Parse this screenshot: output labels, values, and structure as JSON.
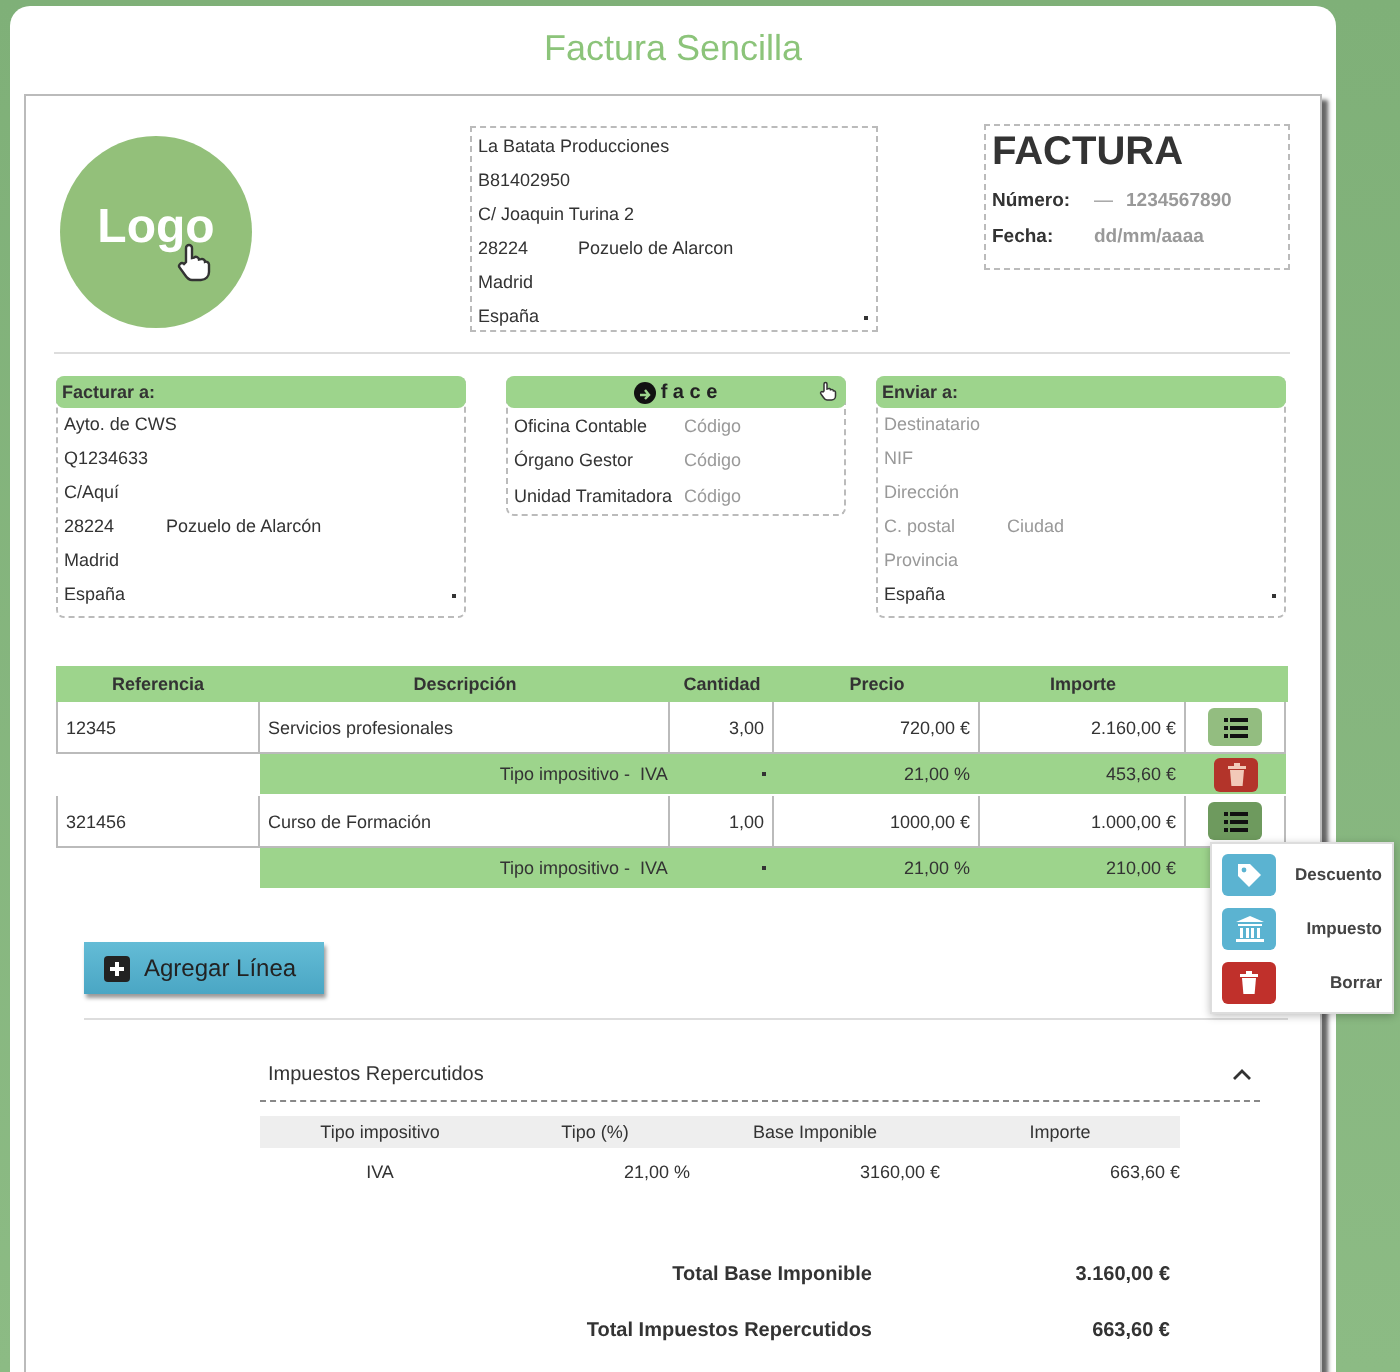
{
  "page_title": "Factura Sencilla",
  "logo": {
    "label": "Logo"
  },
  "issuer": {
    "lines": [
      "La Batata Producciones",
      "B81402950",
      "C/ Joaquin Turina 2"
    ],
    "postal_code": "28224",
    "city": "Pozuelo de Alarcon",
    "province": "Madrid",
    "country": "España"
  },
  "invoice": {
    "title": "FACTURA",
    "number_label": "Número:",
    "number_prefix": "—",
    "number": "1234567890",
    "date_label": "Fecha:",
    "date_placeholder": "dd/mm/aaaa"
  },
  "bill_to": {
    "title": "Facturar a:",
    "rows": [
      [
        {
          "value": "Ayto. de CWS"
        }
      ],
      [
        {
          "value": "Q1234633"
        }
      ],
      [
        {
          "value": "C/Aquí"
        }
      ],
      [
        {
          "value": "28224"
        },
        {
          "value": "Pozuelo de Alarcón"
        }
      ],
      [
        {
          "value": "Madrid"
        }
      ],
      [
        {
          "value": "España",
          "kind": "select"
        }
      ]
    ]
  },
  "face": {
    "label": "f a c e",
    "rows": [
      {
        "label": "Oficina Contable",
        "placeholder": "Código"
      },
      {
        "label": "Órgano Gestor",
        "placeholder": "Código"
      },
      {
        "label": "Unidad Tramitadora",
        "placeholder": "Código"
      }
    ]
  },
  "ship_to": {
    "title": "Enviar a:",
    "rows": [
      [
        {
          "placeholder": "Destinatario"
        }
      ],
      [
        {
          "placeholder": "NIF"
        }
      ],
      [
        {
          "placeholder": "Dirección"
        }
      ],
      [
        {
          "placeholder": "C. postal"
        },
        {
          "placeholder": "Ciudad"
        }
      ],
      [
        {
          "placeholder": "Provincia"
        }
      ],
      [
        {
          "value": "España",
          "kind": "select"
        }
      ]
    ]
  },
  "lines": {
    "columns": [
      "Referencia",
      "Descripción",
      "Cantidad",
      "Precio",
      "Importe"
    ],
    "rows": [
      {
        "reference": "12345",
        "description": "Servicios profesionales",
        "quantity": "3,00",
        "price": "720,00 €",
        "amount": "2.160,00 €",
        "menu_open": false,
        "tax": {
          "label": "Tipo impositivo -",
          "type": "IVA",
          "rate": "21,00",
          "rate_unit": "%",
          "amount": "453,60 €"
        }
      },
      {
        "reference": "321456",
        "description": "Curso de Formación",
        "quantity": "1,00",
        "price": "1000,00 €",
        "amount": "1.000,00 €",
        "menu_open": true,
        "tax": {
          "label": "Tipo impositivo -",
          "type": "IVA",
          "rate": "21,00",
          "rate_unit": "%",
          "amount": "210,00 €"
        }
      }
    ]
  },
  "row_menu": [
    {
      "kind": "discount",
      "label": "Descuento",
      "color": "#5bb3d1"
    },
    {
      "kind": "tax",
      "label": "Impuesto",
      "color": "#5bb3d1"
    },
    {
      "kind": "delete",
      "label": "Borrar",
      "color": "#c0302b"
    }
  ],
  "add_button": {
    "label": "Agregar Línea"
  },
  "taxes": {
    "title": "Impuestos Repercutidos",
    "expanded": true,
    "columns": [
      "Tipo impositivo",
      "Tipo (%)",
      "Base Imponible",
      "Importe"
    ],
    "rows": [
      {
        "type": "IVA",
        "rate": "21,00",
        "rate_unit": "%",
        "base": "3160,00",
        "base_unit": "€",
        "amount": "663,60",
        "amount_unit": "€"
      }
    ]
  },
  "totals": [
    {
      "label": "Total Base Imponible",
      "value": "3.160,00 €"
    },
    {
      "label": "Total Impuestos Repercutidos",
      "value": "663,60 €"
    }
  ]
}
